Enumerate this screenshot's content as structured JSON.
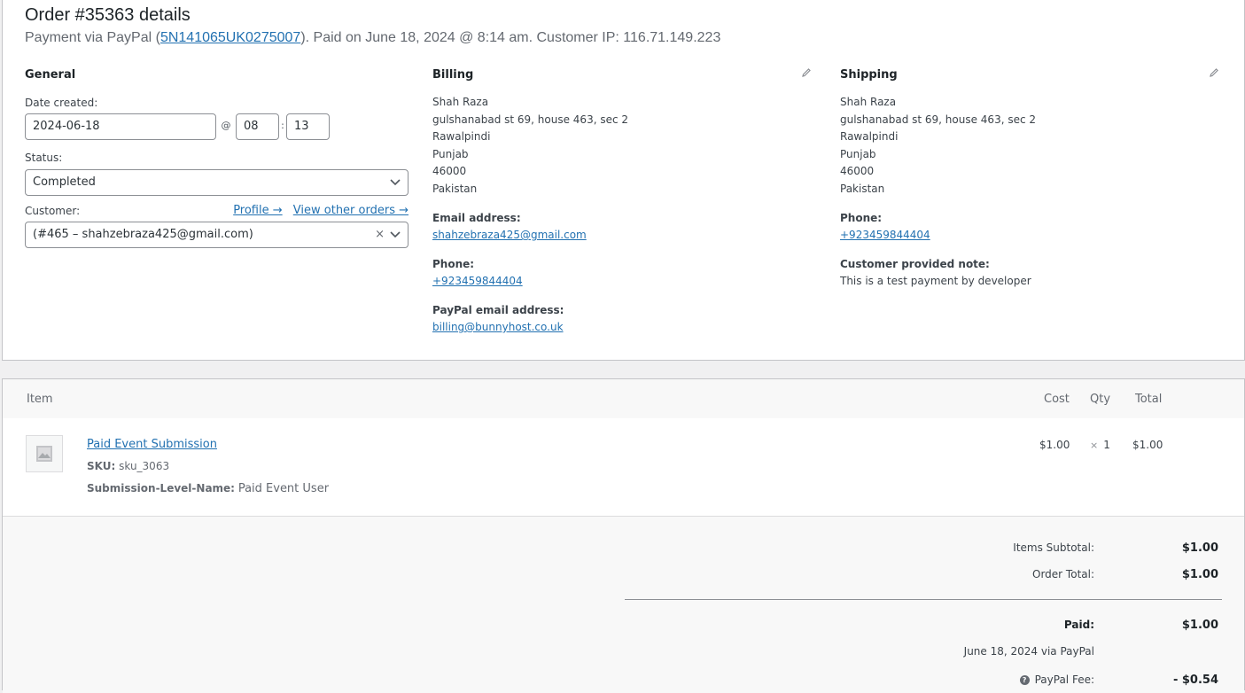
{
  "order": {
    "title": "Order #35363 details",
    "meta_prefix": "Payment via PayPal (",
    "transaction_id": "5N141065UK0275007",
    "meta_suffix": "). Paid on June 18, 2024 @ 8:14 am. Customer IP: 116.71.149.223"
  },
  "general": {
    "heading": "General",
    "date_created_label": "Date created:",
    "date_value": "2024-06-18",
    "at_sep": "@",
    "hour_value": "08",
    "colon_sep": ":",
    "minute_value": "13",
    "status_label": "Status:",
    "status_value": "Completed",
    "customer_label": "Customer:",
    "profile_link": "Profile →",
    "other_orders_link": "View other orders →",
    "customer_value": "(#465 – shahzebraza425@gmail.com)",
    "clear_glyph": "×"
  },
  "billing": {
    "heading": "Billing",
    "address": [
      "Shah Raza",
      "gulshanabad st 69, house 463, sec 2",
      "Rawalpindi",
      "Punjab",
      "46000",
      "Pakistan"
    ],
    "email_label": "Email address:",
    "email": "shahzebraza425@gmail.com",
    "phone_label": "Phone:",
    "phone": "+923459844404",
    "paypal_label": "PayPal email address:",
    "paypal_email": "billing@bunnyhost.co.uk"
  },
  "shipping": {
    "heading": "Shipping",
    "address": [
      "Shah Raza",
      "gulshanabad st 69, house 463, sec 2",
      "Rawalpindi",
      "Punjab",
      "46000",
      "Pakistan"
    ],
    "phone_label": "Phone:",
    "phone": "+923459844404",
    "note_label": "Customer provided note:",
    "note": "This is a test payment by developer"
  },
  "items": {
    "headers": {
      "item": "Item",
      "cost": "Cost",
      "qty": "Qty",
      "total": "Total"
    },
    "rows": [
      {
        "name": "Paid Event Submission",
        "sku_label": "SKU:",
        "sku": "sku_3063",
        "meta_label": "Submission-Level-Name:",
        "meta_value": "Paid Event User",
        "cost": "$1.00",
        "qty_x": "×",
        "qty": "1",
        "total": "$1.00"
      }
    ]
  },
  "totals": {
    "subtotal_label": "Items Subtotal:",
    "subtotal": "$1.00",
    "order_total_label": "Order Total:",
    "order_total": "$1.00",
    "paid_label": "Paid:",
    "paid": "$1.00",
    "paid_note": "June 18, 2024 via PayPal",
    "fee_label": "PayPal Fee:",
    "fee": "- $0.54",
    "help_glyph": "?"
  },
  "colors": {
    "link": "#2271b1",
    "border": "#c3c4c7",
    "text": "#3c434a"
  }
}
